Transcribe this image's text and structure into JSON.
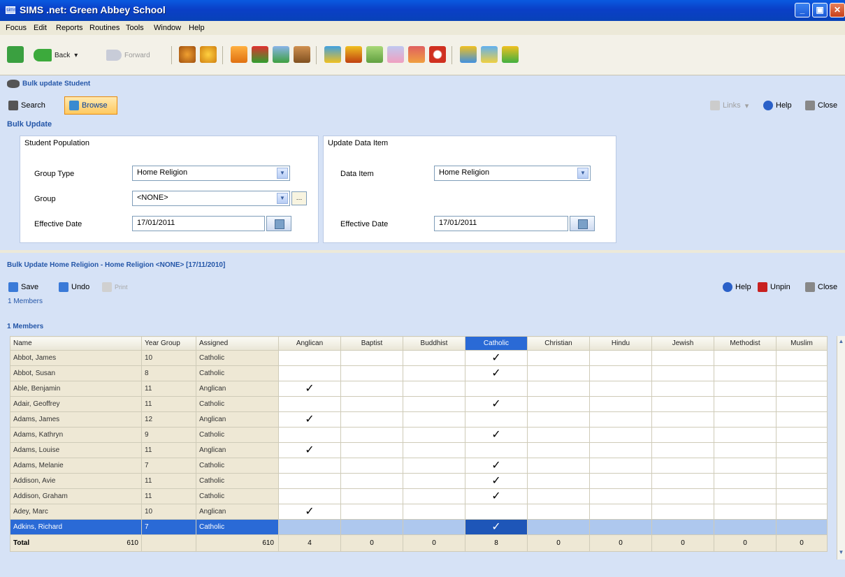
{
  "window": {
    "title": "SIMS .net: Green Abbey School",
    "app_icon_text": "sims"
  },
  "menu": [
    "Focus",
    "Edit",
    "Reports",
    "Routines",
    "Tools",
    "Window",
    "Help"
  ],
  "toolbar": {
    "back_label": "Back",
    "forward_label": "Forward"
  },
  "browse_header": {
    "breadcrumb": "Bulk update Student",
    "search_label": "Search",
    "browse_label": "Browse",
    "links_label": "Links",
    "help_label": "Help",
    "close_label": "Close"
  },
  "bulk_update": {
    "section_title": "Bulk Update",
    "population": {
      "title": "Student Population",
      "group_type_label": "Group Type",
      "group_type_value": "Home Religion",
      "group_label": "Group",
      "group_value": "<NONE>",
      "effective_date_label": "Effective Date",
      "effective_date_value": "17/01/2011"
    },
    "update_item": {
      "title": "Update Data Item",
      "data_item_label": "Data Item",
      "data_item_value": "Home Religion",
      "effective_date_label": "Effective Date",
      "effective_date_value": "17/01/2011"
    }
  },
  "detail": {
    "title": "Bulk Update Home Religion - Home Religion <NONE> [17/11/2010]",
    "save_label": "Save",
    "undo_label": "Undo",
    "print_label": "Print",
    "help_label": "Help",
    "unpin_label": "Unpin",
    "close_label": "Close",
    "members_link": "1 Members",
    "members_header": "1 Members"
  },
  "grid": {
    "columns": [
      "Name",
      "Year Group",
      "Assigned",
      "Anglican",
      "Baptist",
      "Buddhist",
      "Catholic",
      "Christian",
      "Hindu",
      "Jewish",
      "Methodist",
      "Muslim"
    ],
    "selected_column": "Catholic",
    "check_mark": "✓",
    "rows": [
      {
        "name": "Abbot, James",
        "year": "10",
        "assigned": "Catholic"
      },
      {
        "name": "Abbot, Susan",
        "year": "8",
        "assigned": "Catholic"
      },
      {
        "name": "Able, Benjamin",
        "year": "11",
        "assigned": "Anglican"
      },
      {
        "name": "Adair, Geoffrey",
        "year": "11",
        "assigned": "Catholic"
      },
      {
        "name": "Adams, James",
        "year": "12",
        "assigned": "Anglican"
      },
      {
        "name": "Adams, Kathryn",
        "year": "9",
        "assigned": "Catholic"
      },
      {
        "name": "Adams, Louise",
        "year": "11",
        "assigned": "Anglican"
      },
      {
        "name": "Adams, Melanie",
        "year": "7",
        "assigned": "Catholic"
      },
      {
        "name": "Addison, Avie",
        "year": "11",
        "assigned": "Catholic"
      },
      {
        "name": "Addison, Graham",
        "year": "11",
        "assigned": "Catholic"
      },
      {
        "name": "Adey, Marc",
        "year": "10",
        "assigned": "Anglican"
      },
      {
        "name": "Adkins, Richard",
        "year": "7",
        "assigned": "Catholic",
        "selected": true
      }
    ],
    "total": {
      "label": "Total",
      "name_count": "610",
      "assigned_count": "610",
      "religion_counts": [
        "4",
        "0",
        "0",
        "8",
        "0",
        "0",
        "0",
        "0",
        "0"
      ]
    }
  }
}
